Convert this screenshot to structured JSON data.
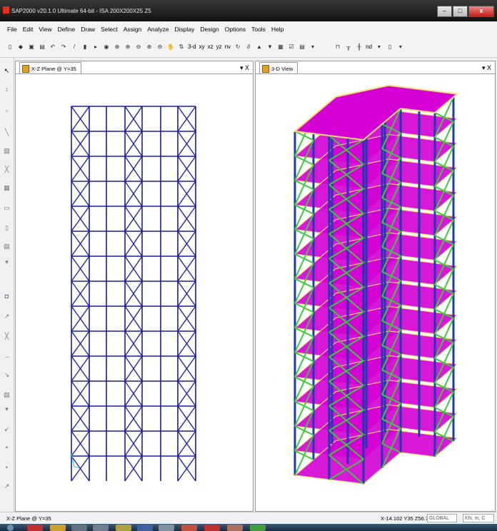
{
  "window": {
    "title": "SAP2000 v20.1.0 Ultimate 64-bit - ISA 200X200X25 Z5",
    "minimize": "–",
    "maximize": "□",
    "close": "x"
  },
  "menu": [
    "File",
    "Edit",
    "View",
    "Define",
    "Draw",
    "Select",
    "Assign",
    "Analyze",
    "Display",
    "Design",
    "Options",
    "Tools",
    "Help"
  ],
  "toolbar": {
    "view_3d": "3-d",
    "view_xy": "xy",
    "view_xz": "xz",
    "view_yz": "yz",
    "view_nv": "nv",
    "nd": "nd"
  },
  "panes": {
    "left": {
      "title": "X-Z Plane @ Y=35",
      "close": "▾ X"
    },
    "right": {
      "title": "3-D View",
      "close": "▾ X"
    }
  },
  "status": {
    "view": "X-Z Plane @ Y=35",
    "coords": "X-14.102  Y35  Z56.7",
    "coord_system": "GLOBAL",
    "units": "KN, m, C"
  },
  "colors": {
    "frame": "#1a1aa0",
    "slab": "#d400d4",
    "beam": "#f2e070",
    "column": "#1a3cb0",
    "brace": "#3ec83e"
  }
}
